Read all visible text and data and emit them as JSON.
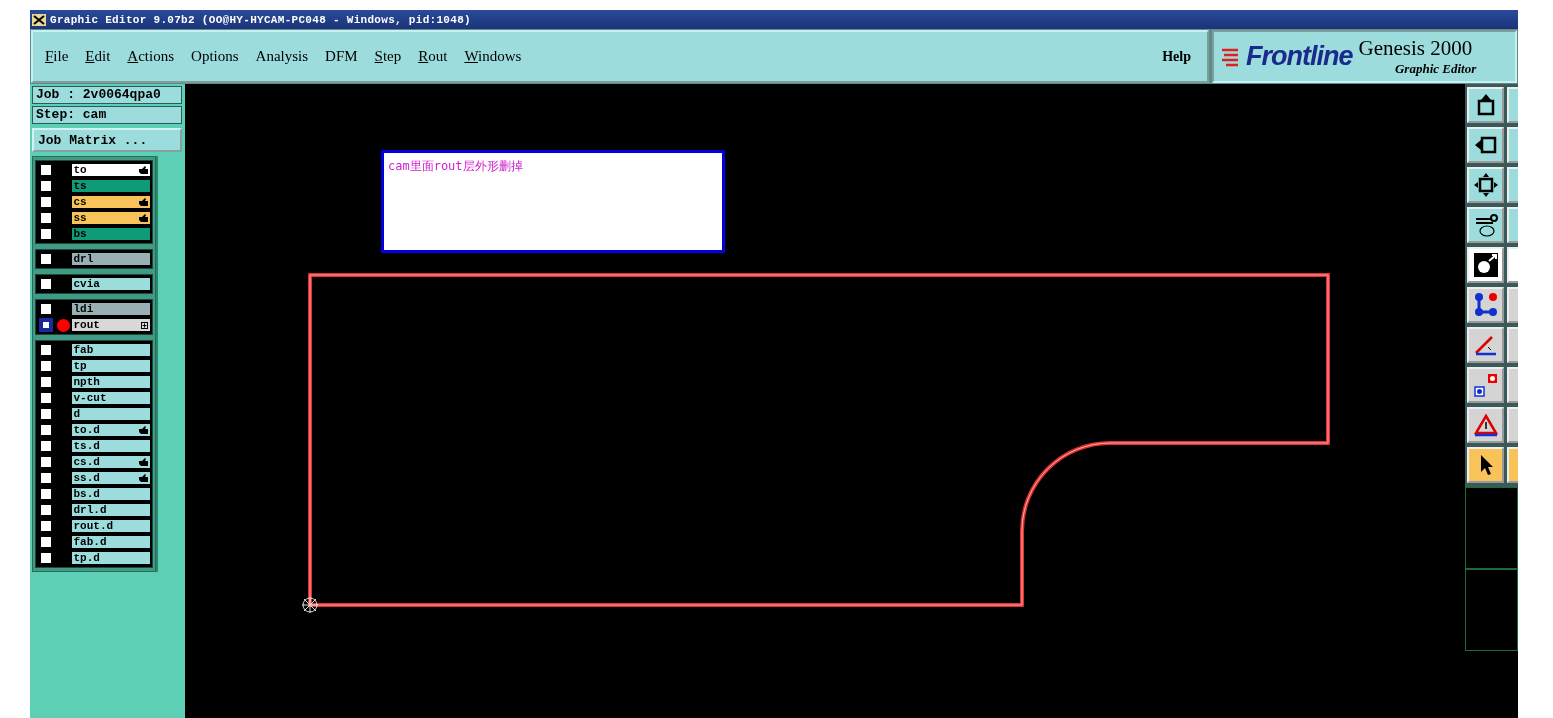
{
  "window": {
    "title": "Graphic Editor 9.07b2 (OO@HY-HYCAM-PC048 - Windows, pid:1048)"
  },
  "menu": [
    {
      "label": "File",
      "underlined": true
    },
    {
      "label": "Edit",
      "underlined": true
    },
    {
      "label": "Actions",
      "underlined": true
    },
    {
      "label": "Options",
      "underlined": false
    },
    {
      "label": "Analysis",
      "underlined": false
    },
    {
      "label": "DFM",
      "underlined": false
    },
    {
      "label": "Step",
      "underlined": true
    },
    {
      "label": "Rout",
      "underlined": true
    },
    {
      "label": "Windows",
      "underlined": true
    }
  ],
  "help": "Help",
  "logo": {
    "brand": "Frontline",
    "product": "Genesis 2000",
    "subtitle": "Graphic Editor"
  },
  "job": "Job : 2v0064qpa0",
  "step": "Step: cam",
  "job_matrix": "Job Matrix ...",
  "layer_groups": [
    [
      {
        "name": "to",
        "color": "#ffffff",
        "pinned": true,
        "selected": false
      },
      {
        "name": "ts",
        "color": "#0f9a78",
        "pinned": false,
        "selected": false
      },
      {
        "name": "cs",
        "color": "#f8c45a",
        "pinned": true,
        "selected": false
      },
      {
        "name": "ss",
        "color": "#f8c45a",
        "pinned": true,
        "selected": false
      },
      {
        "name": "bs",
        "color": "#0f9a78",
        "pinned": false,
        "selected": false
      }
    ],
    [
      {
        "name": "drl",
        "color": "#98b0b4",
        "pinned": false,
        "selected": false
      }
    ],
    [
      {
        "name": "cvia",
        "color": "#9ddcdc",
        "pinned": false,
        "selected": false
      }
    ],
    [
      {
        "name": "ldi",
        "color": "#98b0b4",
        "pinned": false,
        "selected": false
      },
      {
        "name": "rout",
        "color": "#d8d8d8",
        "pinned": false,
        "selected": true
      }
    ],
    [
      {
        "name": "fab",
        "color": "#9ddcdc",
        "pinned": false,
        "selected": false
      },
      {
        "name": "tp",
        "color": "#9ddcdc",
        "pinned": false,
        "selected": false
      },
      {
        "name": "npth",
        "color": "#9ddcdc",
        "pinned": false,
        "selected": false
      },
      {
        "name": "v-cut",
        "color": "#9ddcdc",
        "pinned": false,
        "selected": false
      },
      {
        "name": "d",
        "color": "#9ddcdc",
        "pinned": false,
        "selected": false
      },
      {
        "name": "to.d",
        "color": "#9ddcdc",
        "pinned": true,
        "selected": false
      },
      {
        "name": "ts.d",
        "color": "#9ddcdc",
        "pinned": false,
        "selected": false
      },
      {
        "name": "cs.d",
        "color": "#9ddcdc",
        "pinned": true,
        "selected": false
      },
      {
        "name": "ss.d",
        "color": "#9ddcdc",
        "pinned": true,
        "selected": false
      },
      {
        "name": "bs.d",
        "color": "#9ddcdc",
        "pinned": false,
        "selected": false
      },
      {
        "name": "drl.d",
        "color": "#9ddcdc",
        "pinned": false,
        "selected": false
      },
      {
        "name": "rout.d",
        "color": "#9ddcdc",
        "pinned": false,
        "selected": false
      },
      {
        "name": "fab.d",
        "color": "#9ddcdc",
        "pinned": false,
        "selected": false
      },
      {
        "name": "tp.d",
        "color": "#9ddcdc",
        "pinned": false,
        "selected": false
      }
    ]
  ],
  "note": "cam里面rout层外形删掉",
  "tools": [
    {
      "kind": "move-up"
    },
    {
      "kind": "move-left"
    },
    {
      "kind": "expand"
    },
    {
      "kind": "tools"
    },
    {
      "kind": "pad"
    },
    {
      "kind": "nodes"
    },
    {
      "kind": "angle"
    },
    {
      "kind": "snap"
    },
    {
      "kind": "triangle"
    },
    {
      "kind": "pointer"
    }
  ]
}
